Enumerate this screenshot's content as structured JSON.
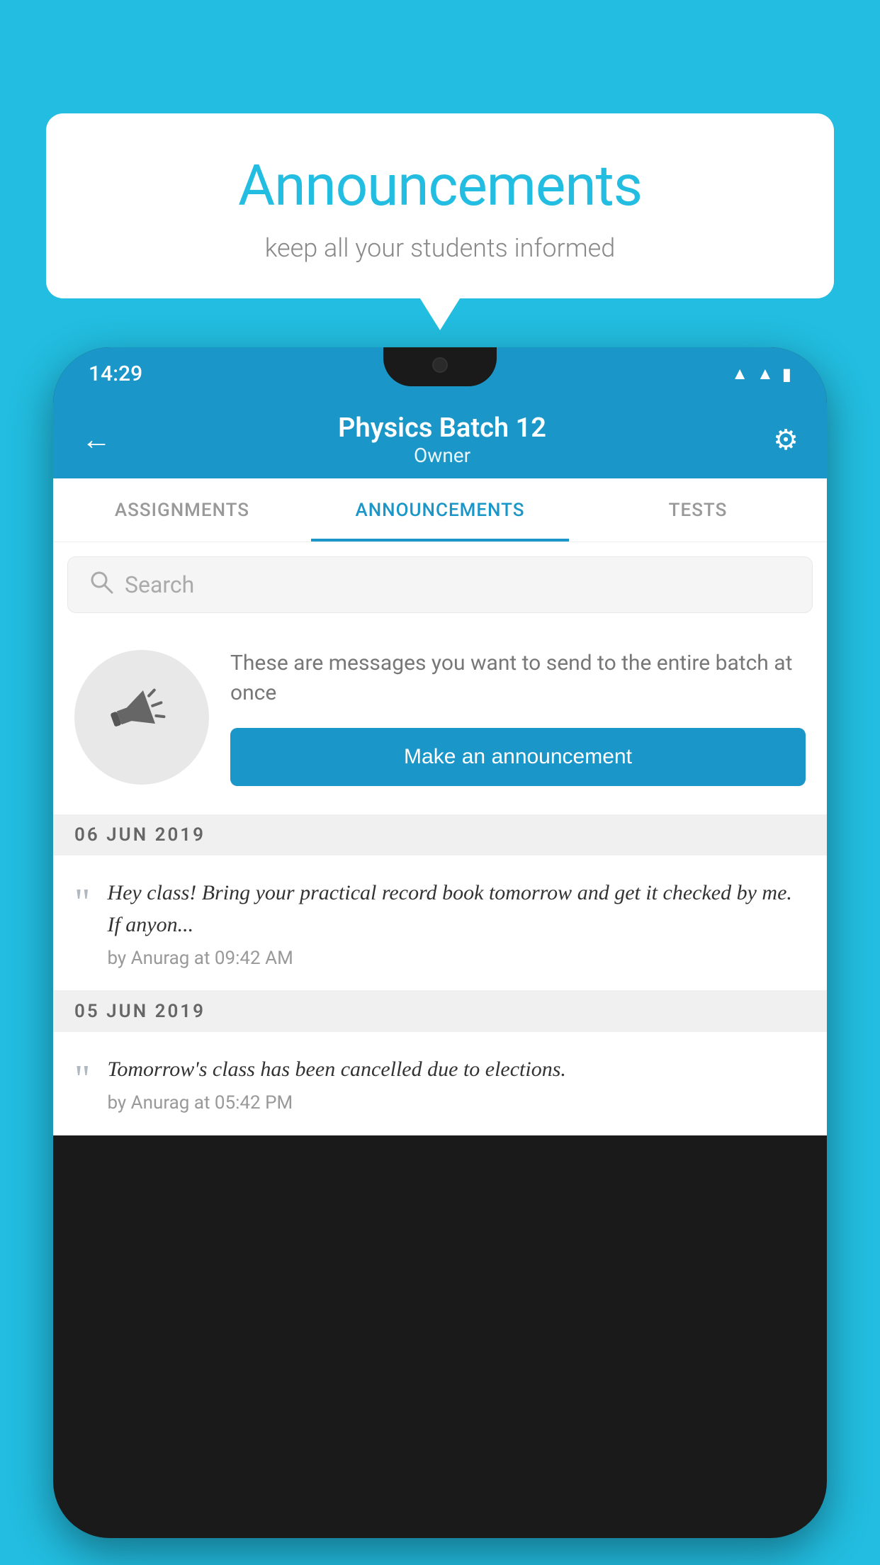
{
  "bubble": {
    "title": "Announcements",
    "subtitle": "keep all your students informed"
  },
  "status_bar": {
    "time": "14:29",
    "icons": [
      "wifi",
      "signal",
      "battery"
    ]
  },
  "header": {
    "title": "Physics Batch 12",
    "subtitle": "Owner",
    "back_label": "←",
    "settings_label": "⚙"
  },
  "tabs": [
    {
      "label": "ASSIGNMENTS",
      "active": false
    },
    {
      "label": "ANNOUNCEMENTS",
      "active": true
    },
    {
      "label": "TESTS",
      "active": false
    }
  ],
  "search": {
    "placeholder": "Search"
  },
  "promo": {
    "description": "These are messages you want to send to the entire batch at once",
    "button_label": "Make an announcement"
  },
  "announcement_groups": [
    {
      "date": "06  JUN  2019",
      "items": [
        {
          "text": "Hey class! Bring your practical record book tomorrow and get it checked by me. If anyon...",
          "author": "by Anurag at 09:42 AM"
        }
      ]
    },
    {
      "date": "05  JUN  2019",
      "items": [
        {
          "text": "Tomorrow's class has been cancelled due to elections.",
          "author": "by Anurag at 05:42 PM"
        }
      ]
    }
  ],
  "colors": {
    "bg": "#22bde0",
    "header_bg": "#1a96c8",
    "accent": "#1a96c8",
    "bubble_title": "#22bde0"
  }
}
